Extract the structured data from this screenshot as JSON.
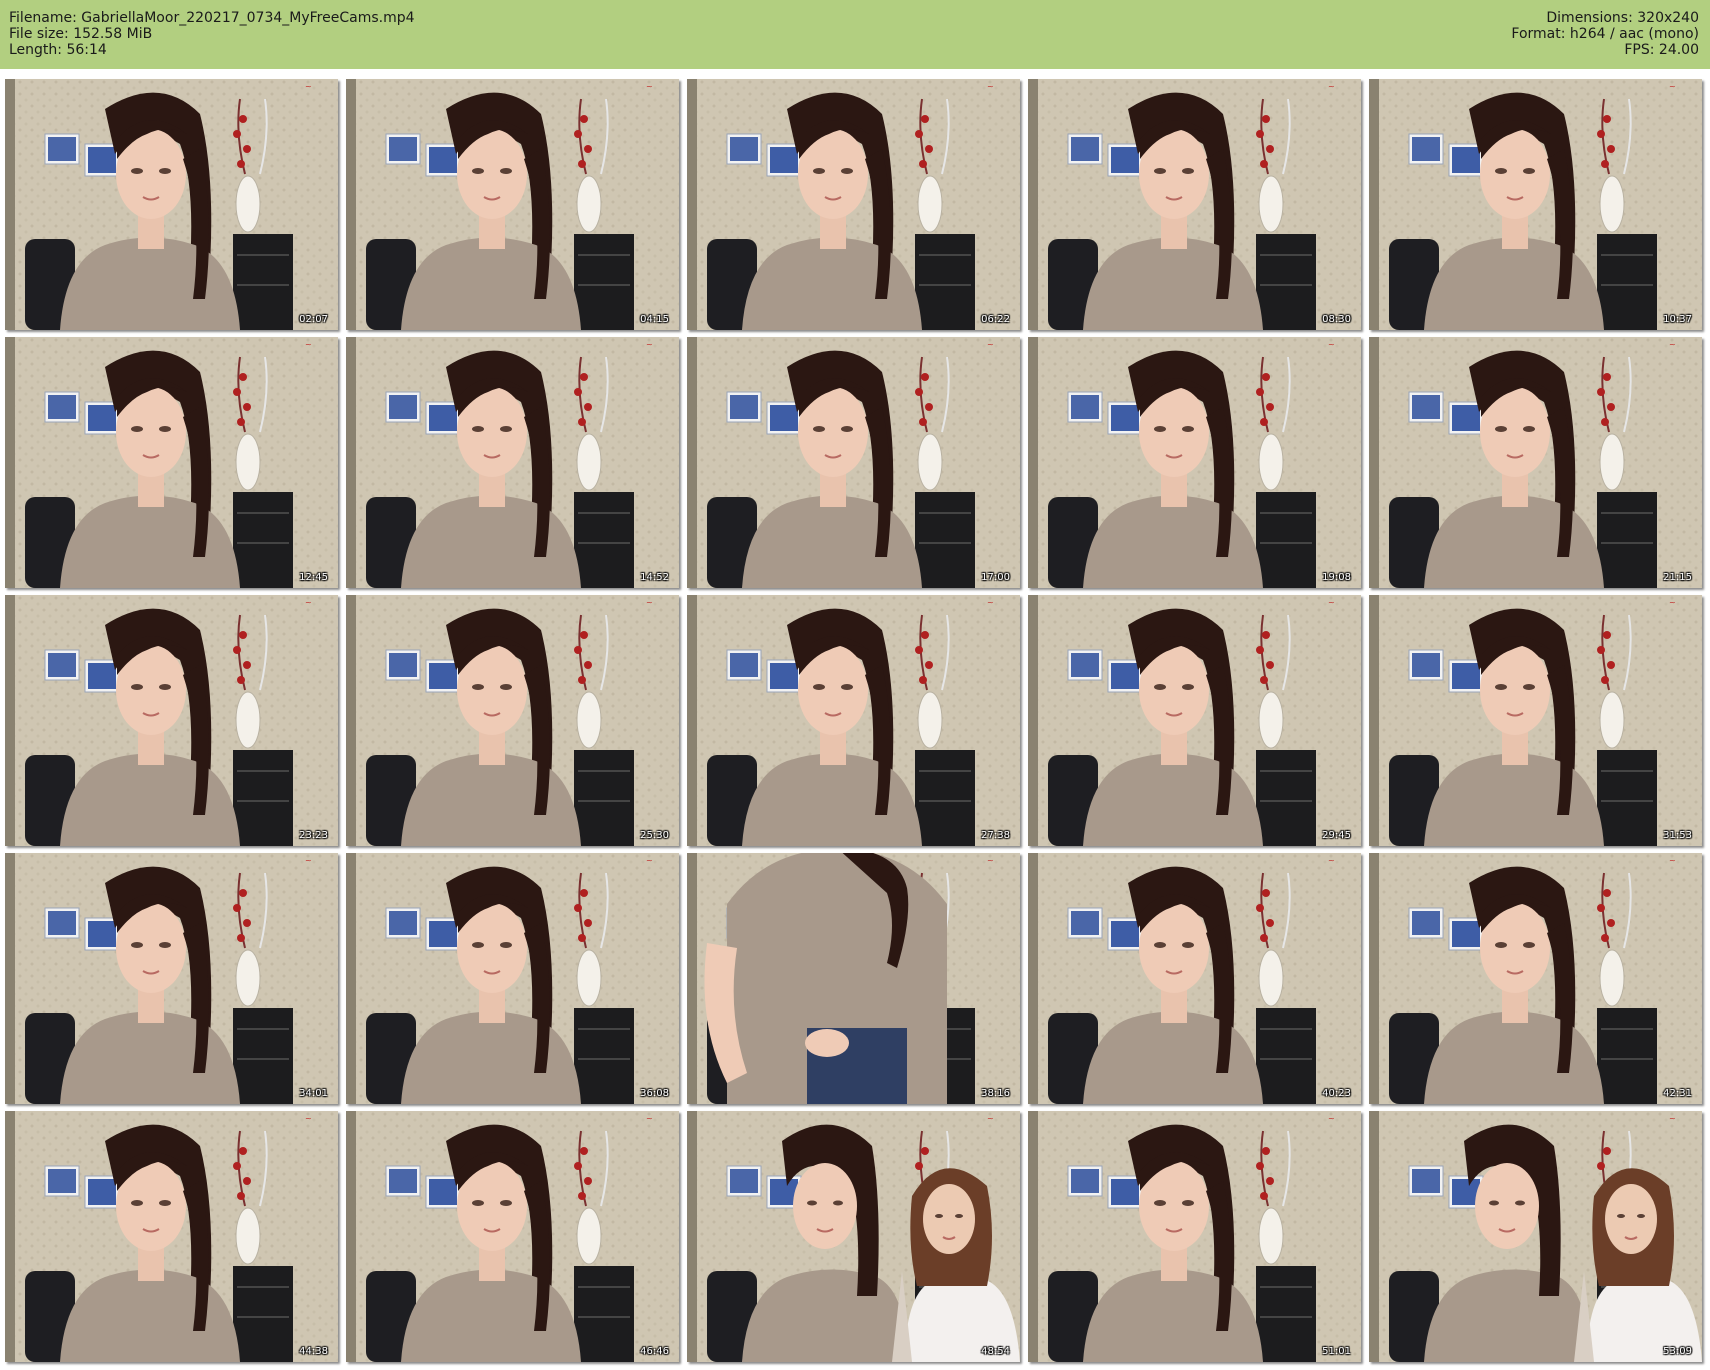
{
  "header": {
    "filename_line": "Filename: GabriellaMoor_220217_0734_MyFreeCams.mp4",
    "filesize_line": "File size: 152.58 MiB",
    "length_line": "Length: 56:14",
    "dimensions_line": "Dimensions: 320x240",
    "format_line": "Format: h264 / aac (mono)",
    "fps_line": "FPS: 24.00",
    "background_color": "#b2cf80"
  },
  "thumbnails": [
    {
      "timestamp": "02:07",
      "variant": "portrait"
    },
    {
      "timestamp": "04:15",
      "variant": "portrait"
    },
    {
      "timestamp": "06:22",
      "variant": "portrait"
    },
    {
      "timestamp": "08:30",
      "variant": "portrait"
    },
    {
      "timestamp": "10:37",
      "variant": "portrait"
    },
    {
      "timestamp": "12:45",
      "variant": "portrait"
    },
    {
      "timestamp": "14:52",
      "variant": "portrait"
    },
    {
      "timestamp": "17:00",
      "variant": "portrait"
    },
    {
      "timestamp": "19:08",
      "variant": "portrait"
    },
    {
      "timestamp": "21:15",
      "variant": "portrait"
    },
    {
      "timestamp": "23:23",
      "variant": "portrait"
    },
    {
      "timestamp": "25:30",
      "variant": "portrait"
    },
    {
      "timestamp": "27:38",
      "variant": "portrait"
    },
    {
      "timestamp": "29:45",
      "variant": "portrait"
    },
    {
      "timestamp": "31:53",
      "variant": "portrait"
    },
    {
      "timestamp": "34:01",
      "variant": "portrait"
    },
    {
      "timestamp": "36:08",
      "variant": "portrait"
    },
    {
      "timestamp": "38:16",
      "variant": "closeup"
    },
    {
      "timestamp": "40:23",
      "variant": "portrait"
    },
    {
      "timestamp": "42:31",
      "variant": "portrait"
    },
    {
      "timestamp": "44:38",
      "variant": "portrait"
    },
    {
      "timestamp": "46:46",
      "variant": "portrait"
    },
    {
      "timestamp": "48:54",
      "variant": "pair"
    },
    {
      "timestamp": "51:01",
      "variant": "portrait"
    },
    {
      "timestamp": "53:09",
      "variant": "pair"
    }
  ]
}
